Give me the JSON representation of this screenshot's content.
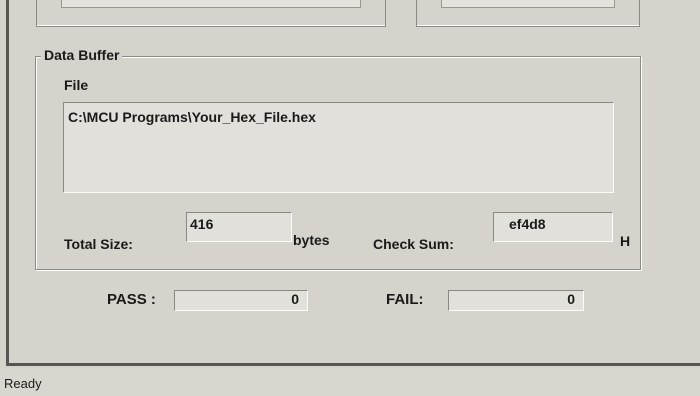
{
  "data_buffer": {
    "title": "Data Buffer",
    "file_label": "File",
    "file_path": "C:\\MCU Programs\\Your_Hex_File.hex",
    "total_size_label": "Total Size:",
    "total_size_value": "416",
    "total_size_unit": "bytes",
    "checksum_label": "Check Sum:",
    "checksum_value": "ef4d8",
    "checksum_unit": "H"
  },
  "results": {
    "pass_label": "PASS :",
    "pass_value": "0",
    "fail_label": "FAIL:",
    "fail_value": "0"
  },
  "status_bar": {
    "text": "Ready"
  }
}
